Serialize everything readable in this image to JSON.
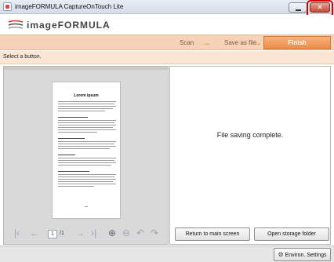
{
  "window": {
    "title": "imageFORMULA CaptureOnTouch Lite",
    "close_glyph": "✕"
  },
  "brand": {
    "logo_text": "imageFORMULA",
    "logo_icon": "imageformula-logo-icon"
  },
  "steps": {
    "scan": "Scan",
    "save_as_file": "Save as file",
    "finish": "Finish",
    "arrow_glyph": "→",
    "accent_color": "#ee8a3a"
  },
  "instruction": "Select a button.",
  "preview": {
    "document_title": "Lorem ipsum",
    "nav": {
      "first_glyph": "|‹",
      "prev_glyph": "←",
      "current_page": "1",
      "total_pages": "/1",
      "next_glyph": "→",
      "last_glyph": "›|",
      "zoom_in_glyph": "⊕",
      "zoom_out_glyph": "⊖",
      "rotate_left_glyph": "↶",
      "rotate_right_glyph": "↷"
    }
  },
  "result": {
    "status_text": "File saving complete."
  },
  "buttons": {
    "return_to_main": "Return to main screen",
    "open_storage_folder": "Open storage folder",
    "environ_settings": "Environ. Settings"
  },
  "icons": {
    "settings_glyph": "⚙"
  }
}
